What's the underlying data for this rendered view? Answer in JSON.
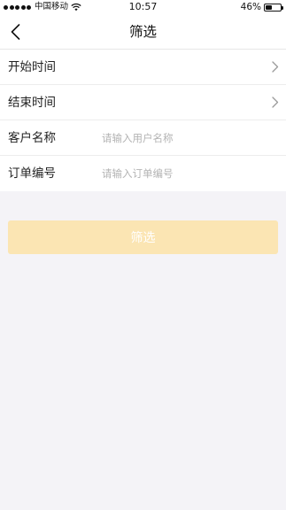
{
  "status_bar": {
    "carrier": "中国移动",
    "time": "10:57",
    "battery_percent": "46%",
    "battery_level": 0.46,
    "icons": [
      "signal-dots-icon",
      "wifi-icon",
      "battery-icon"
    ]
  },
  "nav": {
    "title": "筛选",
    "back_icon": "chevron-left-icon"
  },
  "form": {
    "start_time": {
      "label": "开始时间"
    },
    "end_time": {
      "label": "结束时间"
    },
    "customer_name": {
      "label": "客户名称",
      "placeholder": "请输入用户名称",
      "value": ""
    },
    "order_number": {
      "label": "订单编号",
      "placeholder": "请输入订单编号",
      "value": ""
    }
  },
  "filter_button": {
    "label": "筛选"
  },
  "colors": {
    "button_bg": "#fbe5b3",
    "page_bg": "#f4f3f7",
    "placeholder": "#b3b3b3"
  }
}
